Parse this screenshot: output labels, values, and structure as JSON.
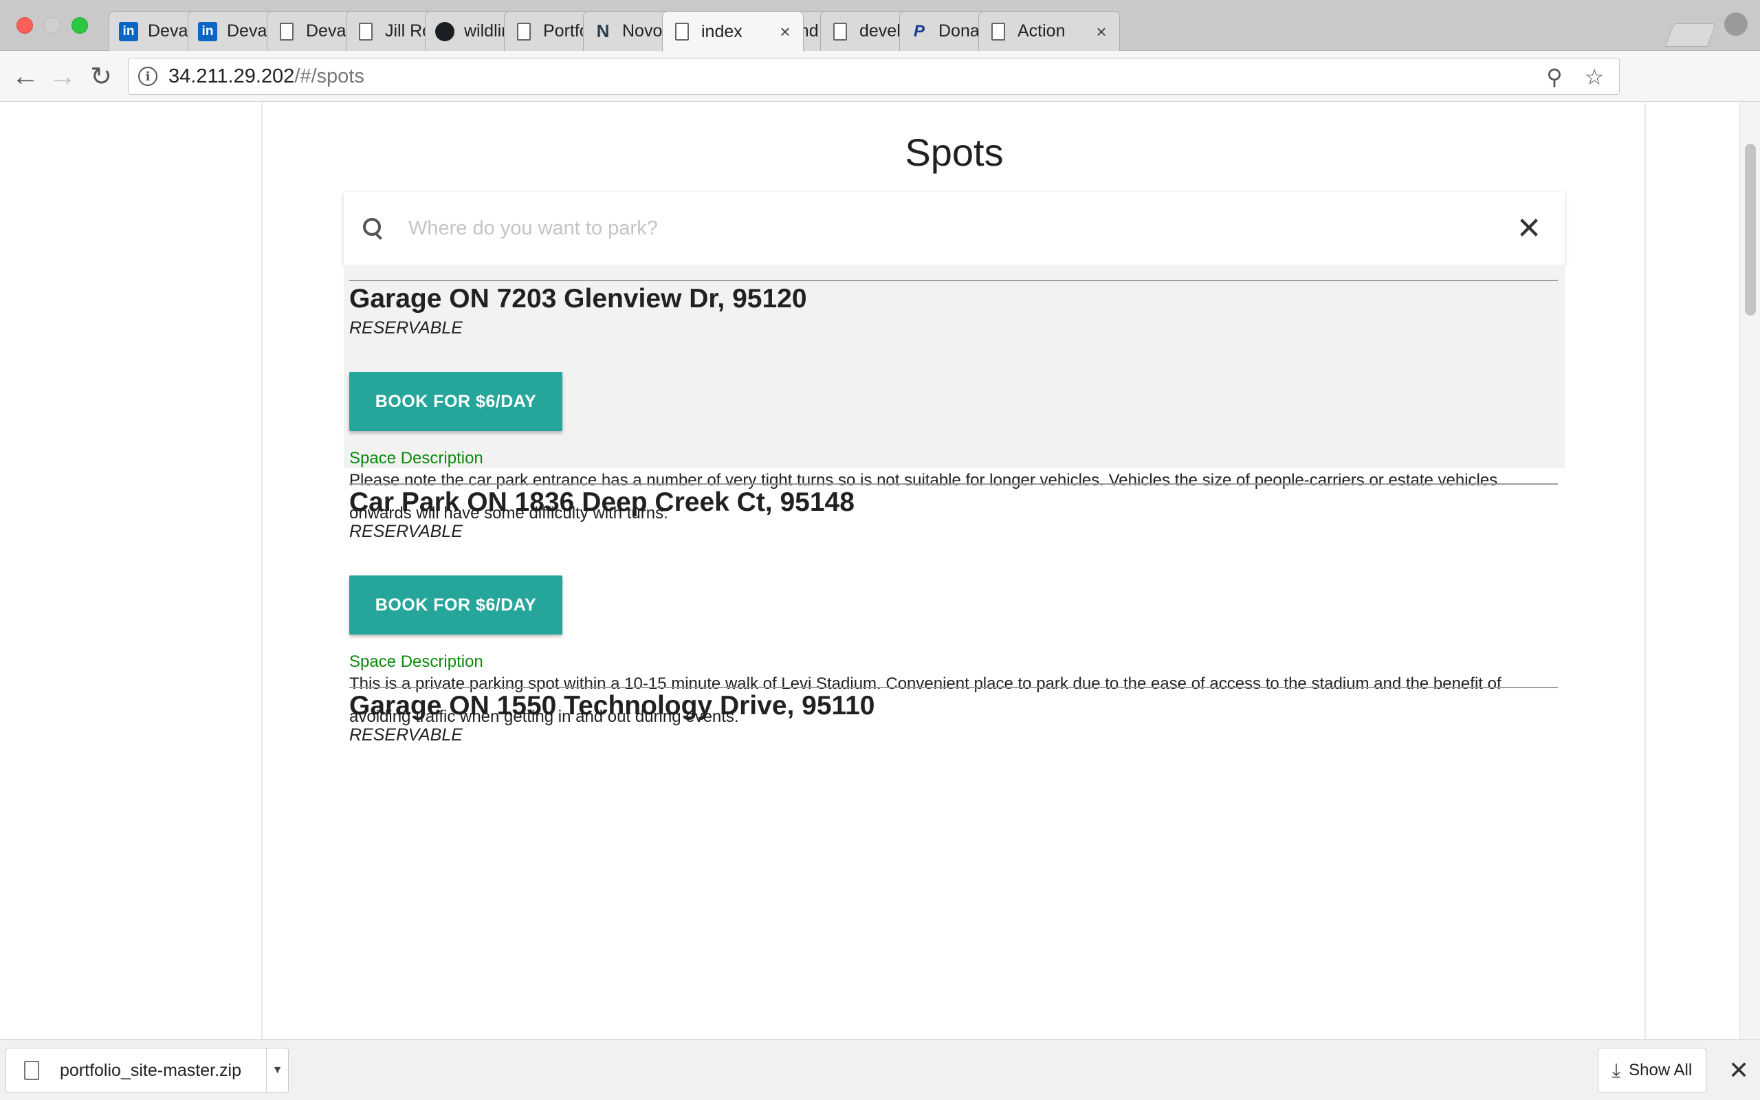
{
  "browser": {
    "tabs": [
      {
        "title": "Devan",
        "icon": "linkedin-icon",
        "icon_text": "in"
      },
      {
        "title": "Devans",
        "icon": "linkedin-icon",
        "icon_text": "in"
      },
      {
        "title": "Devan'",
        "icon": "document-icon",
        "icon_text": ""
      },
      {
        "title": "Jill Rob",
        "icon": "document-icon",
        "icon_text": ""
      },
      {
        "title": "wildling",
        "icon": "github-icon",
        "icon_text": ""
      },
      {
        "title": "Portfoli",
        "icon": "document-icon",
        "icon_text": ""
      },
      {
        "title": "Novoré",
        "icon": "novore-icon",
        "icon_text": "N"
      },
      {
        "title": "index",
        "icon": "document-icon",
        "icon_text": "",
        "active": true
      },
      {
        "title": "Land IT",
        "icon": "land-it-icon",
        "icon_text": ""
      },
      {
        "title": "develo",
        "icon": "document-icon",
        "icon_text": ""
      },
      {
        "title": "Donate",
        "icon": "paypal-icon",
        "icon_text": "P"
      },
      {
        "title": "Action",
        "icon": "document-icon",
        "icon_text": ""
      }
    ],
    "close_glyph": "×",
    "url_host": "34.211.29.202",
    "url_path": "/#/spots"
  },
  "page": {
    "title": "Spots",
    "search": {
      "placeholder": "Where do you want to park?",
      "value": ""
    },
    "spots": [
      {
        "title": "Garage ON 7203 Glenview Dr, 95120",
        "status": "RESERVABLE",
        "button_label": "BOOK FOR $6/DAY",
        "desc_label": "Space Description",
        "description": "Please note the car park entrance has a number of very tight turns so is not suitable for longer vehicles. Vehicles the size of people-carriers or estate vehicles onwards will have some difficulty with turns."
      },
      {
        "title": "Car Park ON 1836 Deep Creek Ct, 95148",
        "status": "RESERVABLE",
        "button_label": "BOOK FOR $6/DAY",
        "desc_label": "Space Description",
        "description": "This is a private parking spot within a 10-15 minute walk of Levi Stadium. Convenient place to park due to the ease of access to the stadium and the benefit of avoiding traffic when getting in and out during events."
      },
      {
        "title": "Garage ON 1550 Technology Drive, 95110",
        "status": "RESERVABLE"
      }
    ]
  },
  "downloads": {
    "file_name": "portfolio_site-master.zip",
    "show_all_label": "Show All"
  },
  "colors": {
    "button": "#26a69a",
    "description_label": "#0a8a0a",
    "hover_row": "#f2f2f2"
  }
}
